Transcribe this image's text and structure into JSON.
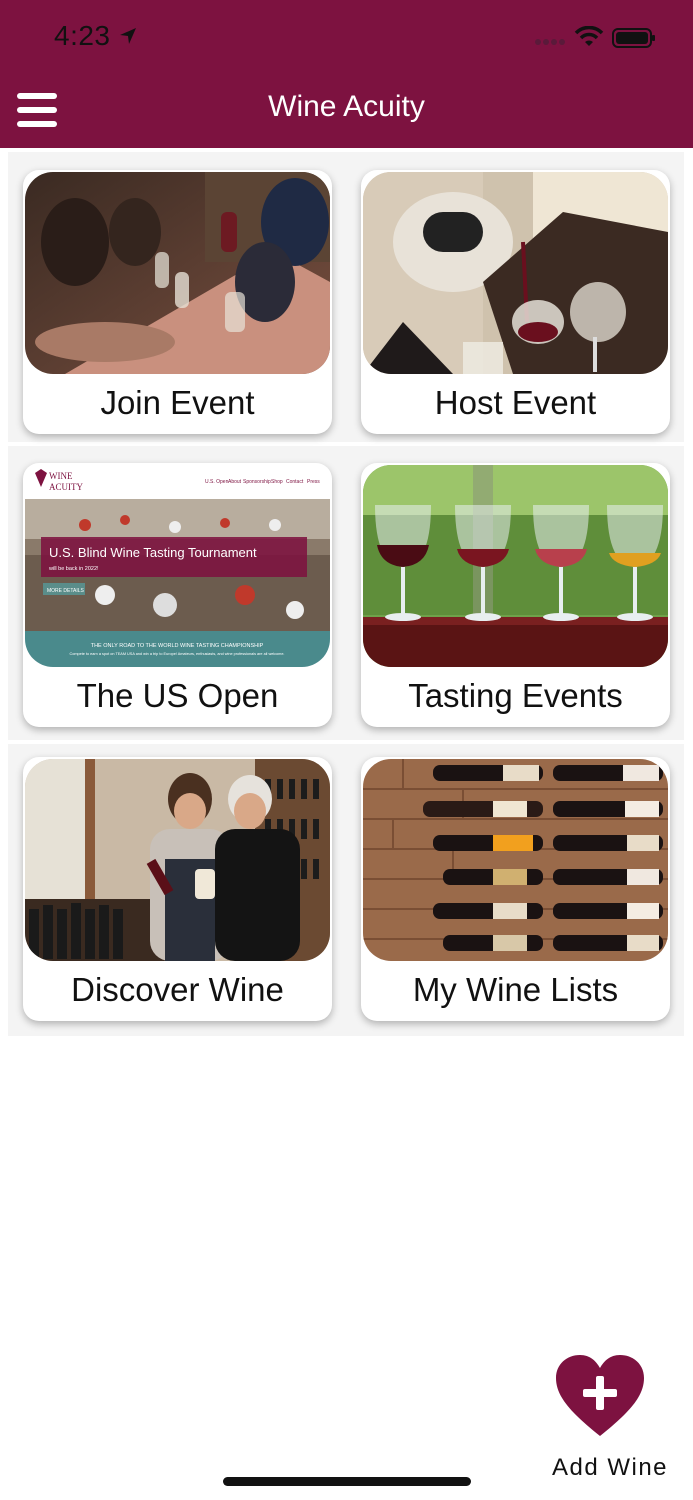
{
  "status_bar": {
    "time": "4:23"
  },
  "app": {
    "title": "Wine Acuity"
  },
  "tiles": [
    {
      "label": "Join Event"
    },
    {
      "label": "Host Event"
    },
    {
      "label": "The US Open"
    },
    {
      "label": "Tasting Events"
    },
    {
      "label": "Discover Wine"
    },
    {
      "label": "My Wine Lists"
    }
  ],
  "us_open_site": {
    "logo_line1": "WINE",
    "logo_line2": "ACUITY",
    "nav": [
      "U.S. Open",
      "About",
      "Sponsorship",
      "Shop",
      "Contact",
      "Press"
    ],
    "banner_title": "U.S. Blind Wine Tasting Tournament",
    "banner_sub": "will be back in 2022!",
    "more_button": "MORE DETAILS",
    "footer_title": "THE ONLY ROAD TO THE WORLD WINE TASTING CHAMPIONSHIP",
    "footer_sub": "Compete to earn a spot on TEAM USA and win a trip to Europe! Amateurs, enthusiasts, and wine professionals are all welcome."
  },
  "fab": {
    "label": "Add Wine"
  },
  "colors": {
    "brand": "#7d1240",
    "background": "#ffffff"
  },
  "icons": {
    "menu": "hamburger-menu-icon",
    "add": "heart-plus-icon",
    "location": "location-arrow-icon"
  }
}
